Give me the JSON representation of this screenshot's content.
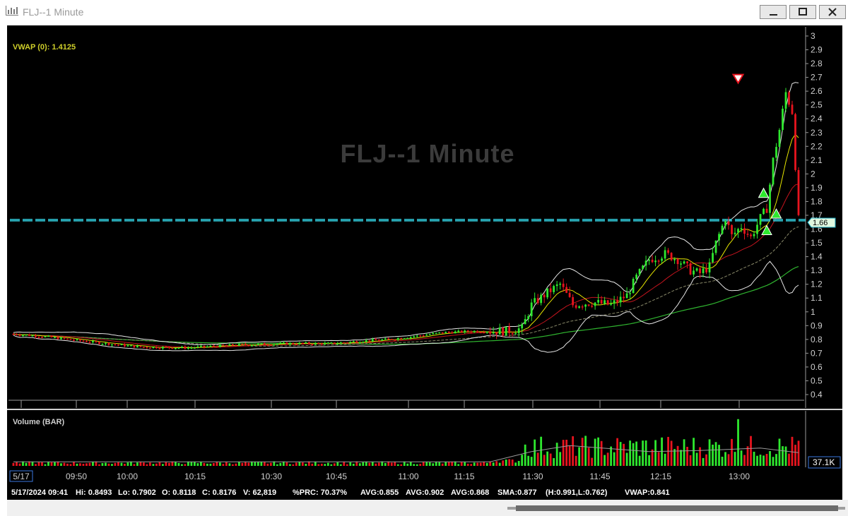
{
  "window": {
    "title": "FLJ--1 Minute"
  },
  "chart_data": {
    "type": "candlestick",
    "title": "FLJ--1 Minute",
    "price_axis": {
      "ticks": [
        "3",
        "2.9",
        "2.8",
        "2.7",
        "2.6",
        "2.5",
        "2.4",
        "2.3",
        "2.2",
        "2.1",
        "2",
        "1.9",
        "1.8",
        "1.7",
        "1.6",
        "1.5",
        "1.4",
        "1.3",
        "1.2",
        "1.1",
        "1",
        "0.9",
        "0.8",
        "0.7",
        "0.6",
        "0.5",
        "0.4"
      ],
      "ylim": [
        0.35,
        3.0
      ]
    },
    "time_axis": {
      "ticks": [
        "5/17",
        "09:50",
        "10:00",
        "10:15",
        "10:30",
        "10:45",
        "11:00",
        "11:15",
        "11:30",
        "11:45",
        "12:15",
        "13:00"
      ]
    },
    "indicator_label": "VWAP (0): 1.4125",
    "last_price_label": "1.66",
    "volume_label": "Volume (BAR)",
    "volume_last_label": "37.1K",
    "price_lines": [
      1.66,
      1.67
    ],
    "markers": [
      {
        "type": "sell",
        "time_index": 228,
        "price": 2.69
      },
      {
        "type": "buy",
        "time_index": 236,
        "price": 1.86
      },
      {
        "type": "buy",
        "time_index": 240,
        "price": 1.71
      },
      {
        "type": "buy",
        "time_index": 237,
        "price": 1.59
      }
    ],
    "colors": {
      "up": "#2ee82e",
      "down": "#e8141e",
      "vwap": "#e6e600",
      "bollinger": "#e6e6e6",
      "sma_green": "#2fb42f",
      "sma_red": "#c4141e",
      "price_line": "#33d0e0",
      "indicator_text": "#cfcf2a"
    }
  },
  "status": {
    "date": "5/17/2024 09:41",
    "hi": "Hi: 0.8493",
    "lo": "Lo: 0.7902",
    "open": "O: 0.8118",
    "close": "C: 0.8176",
    "volume": "V: 62,819",
    "prc": "%PRC: 70.37%",
    "avg1": "AVG:0.855",
    "avg2": "AVG:0.902",
    "avg3": "AVG:0.868",
    "sma": "SMA:0.877",
    "hl": "(H:0.991,L:0.762)",
    "vwap": "VWAP:0.841"
  }
}
